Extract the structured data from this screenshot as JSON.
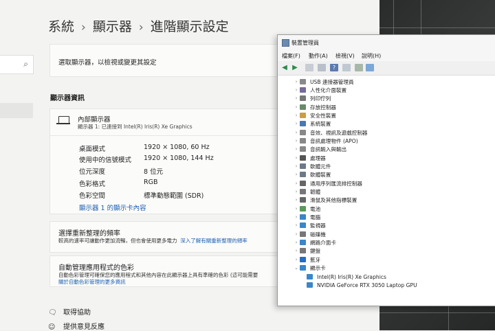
{
  "settings": {
    "breadcrumb": [
      "系統",
      "顯示器",
      "進階顯示設定"
    ],
    "select_display_label": "選取顯示器，以檢視或變更其設定",
    "section_title": "顯示器資訊",
    "display": {
      "name": "內部顯示器",
      "subtitle": "顯示器 1: 已連接到 Intel(R) Iris(R) Xe Graphics",
      "rows": [
        {
          "label": "桌面模式",
          "value": "1920 × 1080, 60 Hz"
        },
        {
          "label": "使用中的信號模式",
          "value": "1920 × 1080, 144 Hz"
        },
        {
          "label": "位元深度",
          "value": "8 位元"
        },
        {
          "label": "色彩格式",
          "value": "RGB"
        },
        {
          "label": "色彩空間",
          "value": "標準動態範圍 (SDR)"
        }
      ],
      "adapter_link": "顯示器 1 的顯示卡內容"
    },
    "refresh_rate": {
      "title": "選擇重新整理的頻率",
      "desc": "較高的速率可讓動作更加流暢，但也會使用更多電力",
      "link": "深入了解有關重新整理的頻率"
    },
    "color_management": {
      "title": "自動管理應用程式的色彩",
      "desc": "自動色彩管理可確保您的應用程式和其他內容在此顯示器上具有準確的色彩 (這可能需要",
      "link": "關於自動色彩管理的更多資訊"
    },
    "help": {
      "get_help": "取得協助",
      "feedback": "提供意見反應"
    }
  },
  "device_manager": {
    "title": "裝置管理員",
    "menu": [
      "檔案(F)",
      "動作(A)",
      "檢視(V)",
      "說明(H)"
    ],
    "tree": [
      {
        "label": "USB 連接器管理員",
        "color": "#8a8a8a"
      },
      {
        "label": "人性化介面裝置",
        "color": "#7a6a9a"
      },
      {
        "label": "列印佇列",
        "color": "#777777"
      },
      {
        "label": "存放控制器",
        "color": "#6a8a6a"
      },
      {
        "label": "安全性裝置",
        "color": "#c8a040"
      },
      {
        "label": "系統裝置",
        "color": "#4a78b0"
      },
      {
        "label": "音效、視訊及遊戲控制器",
        "color": "#888888"
      },
      {
        "label": "音訊處理物件 (APO)",
        "color": "#888888"
      },
      {
        "label": "音訊輸入與輸出",
        "color": "#888888"
      },
      {
        "label": "處理器",
        "color": "#555555"
      },
      {
        "label": "軟體元件",
        "color": "#6a7a8a"
      },
      {
        "label": "軟體裝置",
        "color": "#6a7a8a"
      },
      {
        "label": "通用序列匯流排控制器",
        "color": "#666666"
      },
      {
        "label": "韌體",
        "color": "#777777"
      },
      {
        "label": "滑鼠及其他指標裝置",
        "color": "#666666"
      },
      {
        "label": "電池",
        "color": "#5a9a5a"
      },
      {
        "label": "電腦",
        "color": "#3a86c8"
      },
      {
        "label": "監視器",
        "color": "#3a86c8"
      },
      {
        "label": "磁碟機",
        "color": "#777777"
      },
      {
        "label": "網路介面卡",
        "color": "#3a86c8"
      },
      {
        "label": "鍵盤",
        "color": "#777777"
      },
      {
        "label": "藍牙",
        "color": "#2a6ac8"
      },
      {
        "label": "顯示卡",
        "color": "#3a86c8"
      }
    ],
    "display_adapters": [
      "Intel(R) Iris(R) Xe Graphics",
      "NVIDIA GeForce RTX 3050 Laptop GPU"
    ]
  }
}
